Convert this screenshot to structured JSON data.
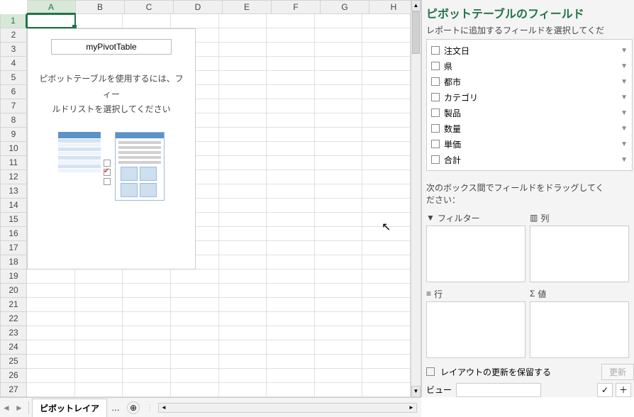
{
  "columns": [
    "A",
    "B",
    "C",
    "D",
    "E",
    "F",
    "G",
    "H"
  ],
  "rows": [
    "1",
    "2",
    "3",
    "4",
    "5",
    "6",
    "7",
    "8",
    "9",
    "10",
    "11",
    "12",
    "13",
    "14",
    "15",
    "16",
    "17",
    "18",
    "19",
    "20",
    "21",
    "22",
    "23",
    "24",
    "25",
    "26",
    "27"
  ],
  "pivot": {
    "name": "myPivotTable",
    "hint_line1": "ピボットテーブルを使用するには、フィー",
    "hint_line2": "ルドリストを選択してください"
  },
  "tab": {
    "active": "ピボットレイア"
  },
  "pane": {
    "title": "ピボットテーブルのフィールド",
    "sub": "レポートに追加するフィールドを選択してくだ",
    "fields": [
      "注文日",
      "県",
      "都市",
      "カテゴリ",
      "製品",
      "数量",
      "単価",
      "合計"
    ],
    "drag_msg1": "次のボックス間でフィールドをドラッグしてく",
    "drag_msg2": "ださい：",
    "area_filter": "フィルター",
    "area_cols": "列",
    "area_rows": "行",
    "area_vals": "値",
    "defer": "レイアウトの更新を保留する",
    "update": "更新",
    "view": "ビュー"
  }
}
